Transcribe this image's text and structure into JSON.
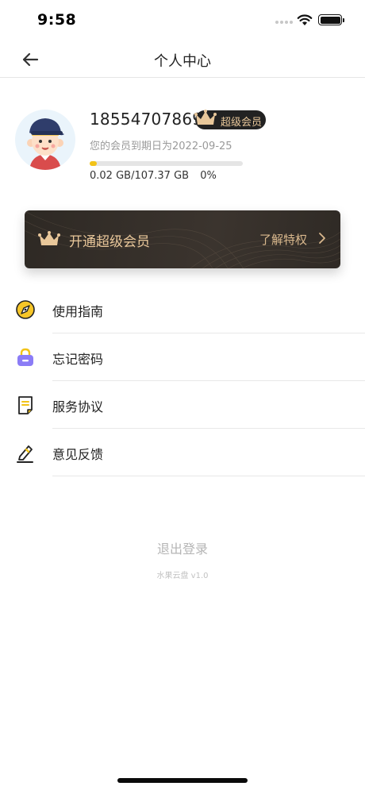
{
  "status_bar": {
    "time": "9:58"
  },
  "nav": {
    "title": "个人中心"
  },
  "profile": {
    "phone": "18554707869",
    "vip_badge": "超级会员",
    "expire_text": "您的会员到期日为2022-09-25",
    "storage_text": "0.02 GB/107.37 GB",
    "storage_percent_text": "0%",
    "storage_fill_fraction": 0.0002
  },
  "vip_banner": {
    "title": "开通超级会员",
    "more": "了解特权"
  },
  "menu": [
    {
      "label": "使用指南",
      "icon": "compass-icon"
    },
    {
      "label": "忘记密码",
      "icon": "lock-icon"
    },
    {
      "label": "服务协议",
      "icon": "document-icon"
    },
    {
      "label": "意见反馈",
      "icon": "pen-icon"
    }
  ],
  "footer": {
    "logout": "退出登录",
    "version": "水果云盘 v1.0"
  },
  "colors": {
    "accent_gold": "#e9c79a",
    "progress": "#f2c318",
    "banner_bg": "#2e2924"
  }
}
